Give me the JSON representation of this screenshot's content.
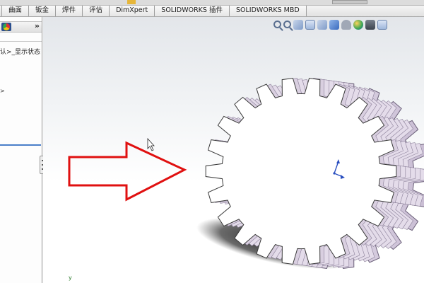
{
  "ribbon": {
    "tabs": [
      {
        "label": "曲面"
      },
      {
        "label": "钣金"
      },
      {
        "label": "焊件"
      },
      {
        "label": "评估"
      },
      {
        "label": "DimXpert"
      },
      {
        "label": "SOLIDWORKS 插件"
      },
      {
        "label": "SOLIDWORKS MBD"
      }
    ]
  },
  "feature_manager": {
    "expand_label": "»",
    "config_text": "认>_显示状态"
  },
  "viewport": {
    "view_toolbar_icons": [
      "zoom-to-fit-icon",
      "zoom-to-area-icon",
      "previous-view-icon",
      "section-view-icon",
      "view-orientation-icon",
      "display-style-icon",
      "hide-show-items-icon",
      "edit-appearance-icon",
      "apply-scene-icon",
      "view-settings-icon"
    ],
    "arrow_color": "#e01010",
    "gear": {
      "teeth": 22,
      "face_color": "#ffffff",
      "side_color": "#d9cfe0"
    }
  }
}
